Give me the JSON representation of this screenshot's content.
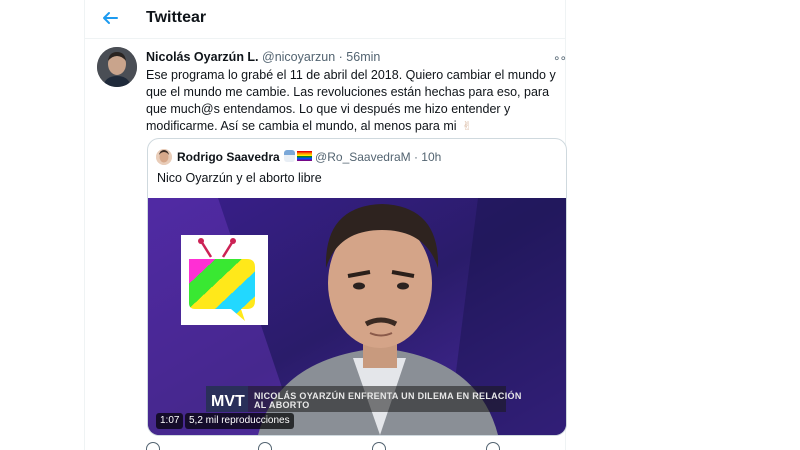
{
  "header": {
    "title": "Twittear",
    "back_icon": "arrow-left-icon",
    "accent": "#1d9bf0"
  },
  "tweet": {
    "author_name": "Nicolás Oyarzún L.",
    "author_handle": "@nicoyarzun",
    "separator": "·",
    "time": "56min",
    "more": "∘∘",
    "text": "Ese programa lo grabé el 11 de abril del 2018. Quiero cambiar el mundo y que el mundo me cambie. Las revoluciones están hechas para eso, para que much@s entendamos. Lo que vi después me hizo entender y modificarme. Así se cambia el mundo, al menos para mi",
    "emoji": "✌"
  },
  "quote": {
    "author_name": "Rodrigo Saavedra",
    "author_handle": "@Ro_SaavedraM",
    "separator": "·",
    "time": "10h",
    "text": "Nico Oyarzún y el aborto libre",
    "video": {
      "duration": "1:07",
      "views": "5,2 mil reproducciones",
      "lower_third": "NICOLÁS OYARZÚN ENFRENTA UN DILEMA EN RELACIÓN AL ABORTO",
      "channel_logo": "MVT"
    }
  },
  "colors": {
    "text": "#0f1419",
    "muted": "#536471",
    "border": "#cfd9de",
    "divider": "#eff3f4"
  }
}
